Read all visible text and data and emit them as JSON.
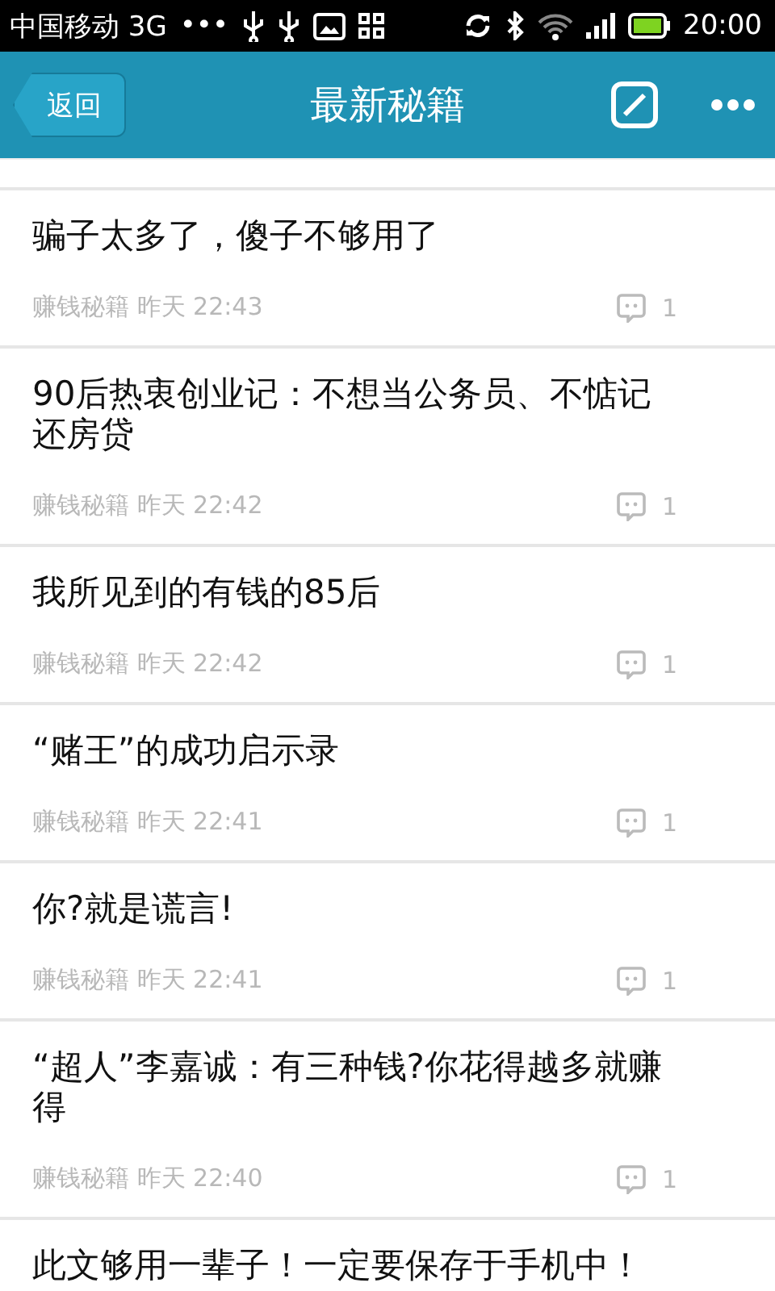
{
  "status_bar": {
    "carrier": "中国移动 3G",
    "dots": "•••",
    "time": "20:00"
  },
  "header": {
    "back": "返回",
    "title": "最新秘籍"
  },
  "posts": [
    {
      "title": "骗子太多了，傻子不够用了",
      "source": "赚钱秘籍",
      "date": "昨天 22:43",
      "comments": "1"
    },
    {
      "title": "90后热衷创业记：不想当公务员、不惦记还房贷",
      "source": "赚钱秘籍",
      "date": "昨天 22:42",
      "comments": "1"
    },
    {
      "title": "我所见到的有钱的85后",
      "source": "赚钱秘籍",
      "date": "昨天 22:42",
      "comments": "1"
    },
    {
      "title": "“赌王”的成功启示录",
      "source": "赚钱秘籍",
      "date": "昨天 22:41",
      "comments": "1"
    },
    {
      "title": "你?就是谎言!",
      "source": "赚钱秘籍",
      "date": "昨天 22:41",
      "comments": "1"
    },
    {
      "title": "“超人”李嘉诚：有三种钱?你花得越多就赚得",
      "source": "赚钱秘籍",
      "date": "昨天 22:40",
      "comments": "1"
    },
    {
      "title": "此文够用一辈子！一定要保存于手机中！"
    }
  ]
}
